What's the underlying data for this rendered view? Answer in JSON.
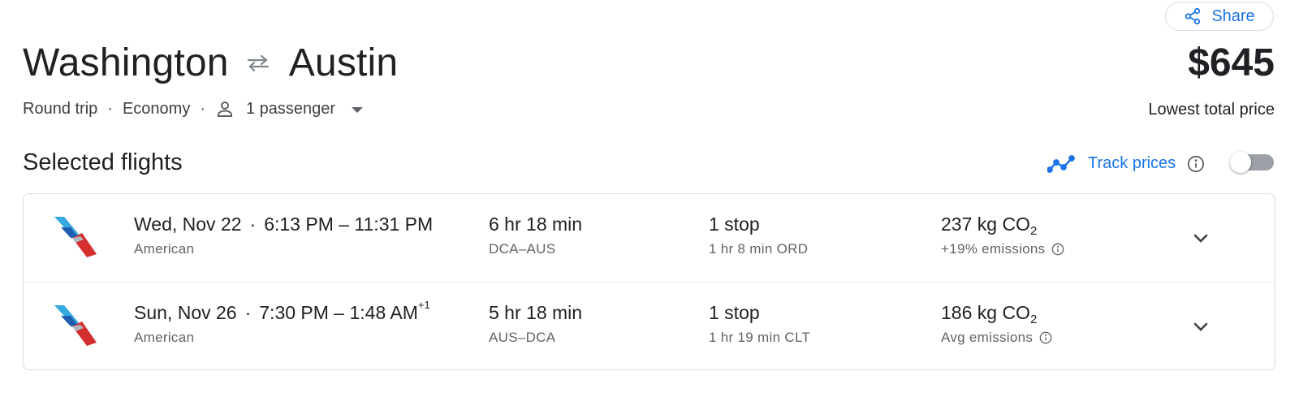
{
  "header": {
    "origin": "Washington",
    "destination": "Austin",
    "trip_type": "Round trip",
    "cabin": "Economy",
    "passengers": "1 passenger",
    "share_label": "Share",
    "price": "$645",
    "price_label": "Lowest total price"
  },
  "selected": {
    "title": "Selected flights",
    "track_label": "Track prices",
    "track_enabled": false
  },
  "flights": [
    {
      "date": "Wed, Nov 22",
      "times": "6:13 PM – 11:31 PM",
      "day_offset": "",
      "airline": "American",
      "duration": "6 hr 18 min",
      "route": "DCA–AUS",
      "stops": "1 stop",
      "layover": "1 hr 8 min ORD",
      "emissions": "237 kg CO",
      "emissions_sub": "2",
      "emissions_note": "+19% emissions"
    },
    {
      "date": "Sun, Nov 26",
      "times": "7:30 PM – 1:48 AM",
      "day_offset": "+1",
      "airline": "American",
      "duration": "5 hr 18 min",
      "route": "AUS–DCA",
      "stops": "1 stop",
      "layover": "1 hr 19 min CLT",
      "emissions": "186 kg CO",
      "emissions_sub": "2",
      "emissions_note": "Avg emissions"
    }
  ],
  "colors": {
    "accent": "#1a73e8",
    "text": "#202124",
    "secondary": "#5f6368",
    "border": "#dadce0"
  },
  "icons": {
    "share": "share-icon",
    "swap": "swap-arrows-icon",
    "person": "person-icon",
    "caret": "caret-down-icon",
    "trend": "price-trend-icon",
    "info": "info-icon",
    "expand": "chevron-down-icon",
    "logo": "american-airlines-logo"
  }
}
